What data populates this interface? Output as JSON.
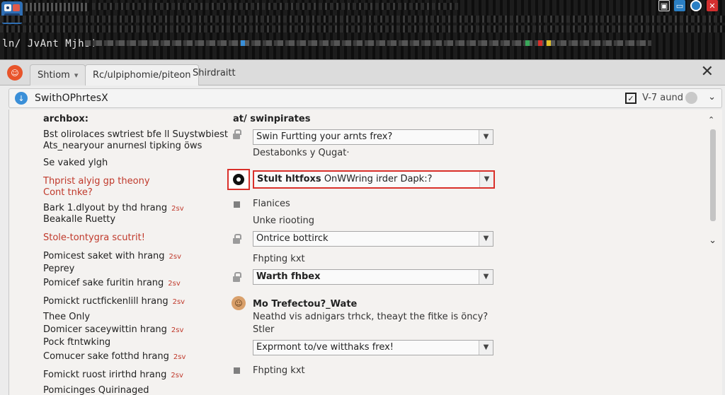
{
  "topbar": {
    "title": "ln/ JvAnt Mjhs!",
    "controls": [
      "window-icon",
      "monitor-icon",
      "circle-icon",
      "close-icon"
    ],
    "control_colors": [
      "#e9e9e9",
      "#2a7fc4",
      "#ffffff",
      "#d32f2f"
    ]
  },
  "tabs": {
    "tab1": "Shtiom",
    "tab2": "Rc/ulpiphomie/piteon",
    "tab3": "Shirdraitt"
  },
  "subbar": {
    "title": "SwithOPhrtesX",
    "zoom": "V-7 aund"
  },
  "left": {
    "header": "archbox:",
    "l1": "Bst olirolaces swtriest bfe ll Suystwbiest",
    "l2": "Ats_nearyour anurnesl tipking öws",
    "l3": "Se vaked ylgh",
    "l4": "Thprist alyig gp theony",
    "l5": "Cont tnke?",
    "l6": "Bark 1.dlyout by thd hrang",
    "l6b": "2sv",
    "l7": "Beakalle Ruetty",
    "l8": "Stole-tontygra scutrit!",
    "l9": "Pomicest saket with hrang",
    "l9b": "2sv",
    "l10": "Peprey",
    "l11": "Pomicef sake furitin hrang",
    "l11b": "2sv",
    "l12": "Pomickt ructfickenlill hrang",
    "l12b": "2sv",
    "l13": "Thee Only",
    "l14": "Domicer saceywittin hrang",
    "l14b": "2sv",
    "l15": "Pock ftntwking",
    "l16": "Comucer sake fotthd hrang",
    "l16b": "2sv",
    "l17": "Fomickt ruost irirthd hrang",
    "l17b": "2sv",
    "l18": "Pomicinges Quirinaged"
  },
  "right": {
    "header": "at/ swinpirates",
    "dd1": "Swin Furtting your arnts frex?",
    "label1": "Destabonks y Qugat·",
    "dd2_bold": "Stult hltfoxs",
    "dd2": "OnWWring irder Dapk:?",
    "label2": "Flanices",
    "label3": "Unke riooting",
    "dd3": "Ontrice bottirck",
    "label4": "Fhpting kxt",
    "dd4": "Warth fhbex",
    "q_title": "Mo Trefectou?_Wate",
    "q_text": "Neathd vis adnigars trhck, theayt the fitke is öncy?",
    "q_sub": "Stler",
    "dd5": "Exprmont to/ve witthaks frex!",
    "label5": "Fhpting kxt"
  },
  "colors": {
    "accent_red": "#d9302a",
    "tab_logo": "#e8542a",
    "info_blue": "#3a8fd8"
  }
}
